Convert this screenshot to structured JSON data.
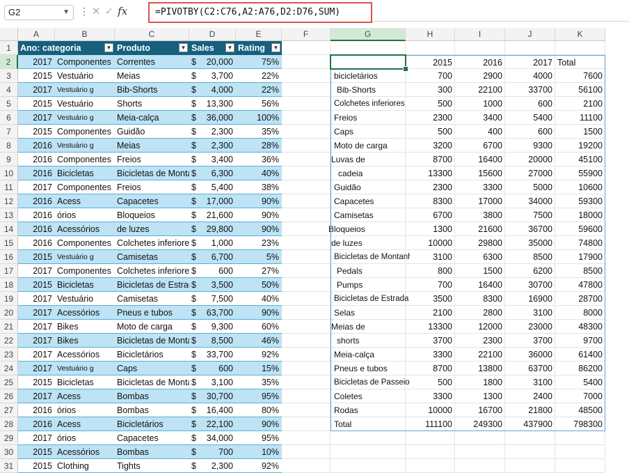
{
  "namebox": "G2",
  "formula": "=PIVOTBY(C2:C76,A2:A76,D2:D76,SUM)",
  "columns": [
    "A",
    "B",
    "C",
    "D",
    "E",
    "F",
    "G",
    "H",
    "I",
    "J",
    "K"
  ],
  "rows": [
    "1",
    "2",
    "3",
    "4",
    "5",
    "6",
    "7",
    "8",
    "9",
    "10",
    "11",
    "12",
    "13",
    "14",
    "15",
    "16",
    "17",
    "18",
    "19",
    "20",
    "21",
    "22",
    "23",
    "24",
    "25",
    "26",
    "27",
    "28",
    "29",
    "30",
    "31"
  ],
  "table_headers": [
    "Ano: categoria",
    "Produto",
    "Sales",
    "Rating"
  ],
  "table": [
    {
      "ano": "2017",
      "cat": "Componentes",
      "prod": "Correntes",
      "sales": "20,000",
      "rating": "75%"
    },
    {
      "ano": "2015",
      "cat": "Vestuário",
      "prod": "Meias",
      "sales": "3,700",
      "rating": "22%"
    },
    {
      "ano": "2017",
      "cat": "Vestuário g",
      "prod": "Bib-Shorts",
      "sales": "4,000",
      "rating": "22%"
    },
    {
      "ano": "2015",
      "cat": "Vestuário",
      "prod": "Shorts",
      "sales": "13,300",
      "rating": "56%"
    },
    {
      "ano": "2017",
      "cat": "Vestuário g",
      "prod": "Meia-calça",
      "sales": "36,000",
      "rating": "100%"
    },
    {
      "ano": "2015",
      "cat": "Componentes",
      "prod": "Guidão",
      "sales": "2,300",
      "rating": "35%"
    },
    {
      "ano": "2016",
      "cat": "Vestuário g",
      "prod": "Meias",
      "sales": "2,300",
      "rating": "28%"
    },
    {
      "ano": "2016",
      "cat": "Componentes",
      "prod": "Freios",
      "sales": "3,400",
      "rating": "36%"
    },
    {
      "ano": "2016",
      "cat": "Bicicletas",
      "prod": "Bicicletas de Montanha",
      "sales": "6,300",
      "rating": "40%"
    },
    {
      "ano": "2017",
      "cat": "Componentes",
      "prod": "Freios",
      "sales": "5,400",
      "rating": "38%"
    },
    {
      "ano": "2016",
      "cat": "Acess",
      "prod": "Capacetes",
      "sales": "17,000",
      "rating": "90%"
    },
    {
      "ano": "2016",
      "cat": "órios",
      "prod": "Bloqueios",
      "sales": "21,600",
      "rating": "90%"
    },
    {
      "ano": "2016",
      "cat": "Acessórios",
      "prod": "de luzes",
      "sales": "29,800",
      "rating": "90%"
    },
    {
      "ano": "2016",
      "cat": "Componentes",
      "prod": "Colchetes inferiores",
      "sales": "1,000",
      "rating": "23%"
    },
    {
      "ano": "2015",
      "cat": "Vestuário g",
      "prod": "Camisetas",
      "sales": "6,700",
      "rating": "5%"
    },
    {
      "ano": "2017",
      "cat": "Componentes",
      "prod": "Colchetes inferiores",
      "sales": "600",
      "rating": "27%"
    },
    {
      "ano": "2015",
      "cat": "Bicicletas",
      "prod": "Bicicletas de Estrada",
      "sales": "3,500",
      "rating": "50%"
    },
    {
      "ano": "2017",
      "cat": "Vestuário",
      "prod": "Camisetas",
      "sales": "7,500",
      "rating": "40%"
    },
    {
      "ano": "2017",
      "cat": "Acessórios",
      "prod": "Pneus e tubos",
      "sales": "63,700",
      "rating": "90%"
    },
    {
      "ano": "2017",
      "cat": "Bikes",
      "prod": "Moto de carga",
      "sales": "9,300",
      "rating": "60%"
    },
    {
      "ano": "2017",
      "cat": "Bikes",
      "prod": "Bicicletas de Montanha",
      "sales": "8,500",
      "rating": "46%"
    },
    {
      "ano": "2017",
      "cat": "Acessórios",
      "prod": "Bicicletários",
      "sales": "33,700",
      "rating": "92%"
    },
    {
      "ano": "2017",
      "cat": "Vestuário g",
      "prod": "Caps",
      "sales": "600",
      "rating": "15%"
    },
    {
      "ano": "2015",
      "cat": "Bicicletas",
      "prod": "Bicicletas de Montanha",
      "sales": "3,100",
      "rating": "35%"
    },
    {
      "ano": "2017",
      "cat": "Acess",
      "prod": "Bombas",
      "sales": "30,700",
      "rating": "95%"
    },
    {
      "ano": "2016",
      "cat": "órios",
      "prod": "Bombas",
      "sales": "16,400",
      "rating": "80%"
    },
    {
      "ano": "2016",
      "cat": "Acess",
      "prod": "Bicicletários",
      "sales": "22,100",
      "rating": "90%"
    },
    {
      "ano": "2017",
      "cat": "órios",
      "prod": "Capacetes",
      "sales": "34,000",
      "rating": "95%"
    },
    {
      "ano": "2015",
      "cat": "Acessórios",
      "prod": "Bombas",
      "sales": "700",
      "rating": "10%"
    },
    {
      "ano": "2015",
      "cat": "Clothing",
      "prod": "Tights",
      "sales": "2,300",
      "rating": "92%"
    }
  ],
  "pivot_header": [
    "",
    "2015",
    "2016",
    "2017",
    "Total"
  ],
  "pivot": [
    {
      "label": "bicicletários",
      "v": [
        "700",
        "2900",
        "4000",
        "7600"
      ]
    },
    {
      "label": "Bib-Shorts",
      "v": [
        "300",
        "22100",
        "33700",
        "56100"
      ]
    },
    {
      "label": "Colchetes inferiores",
      "v": [
        "500",
        "1000",
        "600",
        "2100"
      ]
    },
    {
      "label": "Freios",
      "v": [
        "2300",
        "3400",
        "5400",
        "11100"
      ]
    },
    {
      "label": "Caps",
      "v": [
        "500",
        "400",
        "600",
        "1500"
      ]
    },
    {
      "label": "Moto de carga",
      "v": [
        "3200",
        "6700",
        "9300",
        "19200"
      ]
    },
    {
      "label": "Luvas de",
      "v": [
        "8700",
        "16400",
        "20000",
        "45100"
      ]
    },
    {
      "label": "cadeia",
      "v": [
        "13300",
        "15600",
        "27000",
        "55900"
      ]
    },
    {
      "label": "Guidão",
      "v": [
        "2300",
        "3300",
        "5000",
        "10600"
      ]
    },
    {
      "label": "Capacetes",
      "v": [
        "8300",
        "17000",
        "34000",
        "59300"
      ]
    },
    {
      "label": "Camisetas",
      "v": [
        "6700",
        "3800",
        "7500",
        "18000"
      ]
    },
    {
      "label": "Bloqueios",
      "v": [
        "1300",
        "21600",
        "36700",
        "59600"
      ]
    },
    {
      "label": "de luzes",
      "v": [
        "10000",
        "29800",
        "35000",
        "74800"
      ]
    },
    {
      "label": "Bicicletas de Montanha",
      "v": [
        "3100",
        "6300",
        "8500",
        "17900"
      ]
    },
    {
      "label": "Pedals",
      "v": [
        "800",
        "1500",
        "6200",
        "8500"
      ]
    },
    {
      "label": "Pumps",
      "v": [
        "700",
        "16400",
        "30700",
        "47800"
      ]
    },
    {
      "label": "Bicicletas de Estrada",
      "v": [
        "3500",
        "8300",
        "16900",
        "28700"
      ]
    },
    {
      "label": "Selas",
      "v": [
        "2100",
        "2800",
        "3100",
        "8000"
      ]
    },
    {
      "label": "Meias de",
      "v": [
        "13300",
        "12000",
        "23000",
        "48300"
      ]
    },
    {
      "label": "shorts",
      "v": [
        "3700",
        "2300",
        "3700",
        "9700"
      ]
    },
    {
      "label": "Meia-calça",
      "v": [
        "3300",
        "22100",
        "36000",
        "61400"
      ]
    },
    {
      "label": "Pneus e tubos",
      "v": [
        "8700",
        "13800",
        "63700",
        "86200"
      ]
    },
    {
      "label": "Bicicletas de Passeio",
      "v": [
        "500",
        "1800",
        "3100",
        "5400"
      ]
    },
    {
      "label": "Coletes",
      "v": [
        "3300",
        "1300",
        "2400",
        "7000"
      ]
    },
    {
      "label": "Rodas",
      "v": [
        "10000",
        "16700",
        "21800",
        "48500"
      ]
    },
    {
      "label": "Total",
      "v": [
        "111100",
        "249300",
        "437900",
        "798300"
      ]
    }
  ],
  "currency_symbol": "$",
  "colors": {
    "table_header": "#16607e",
    "band": "#bde3f5",
    "selection": "#217346",
    "highlight": "#e0504c"
  }
}
